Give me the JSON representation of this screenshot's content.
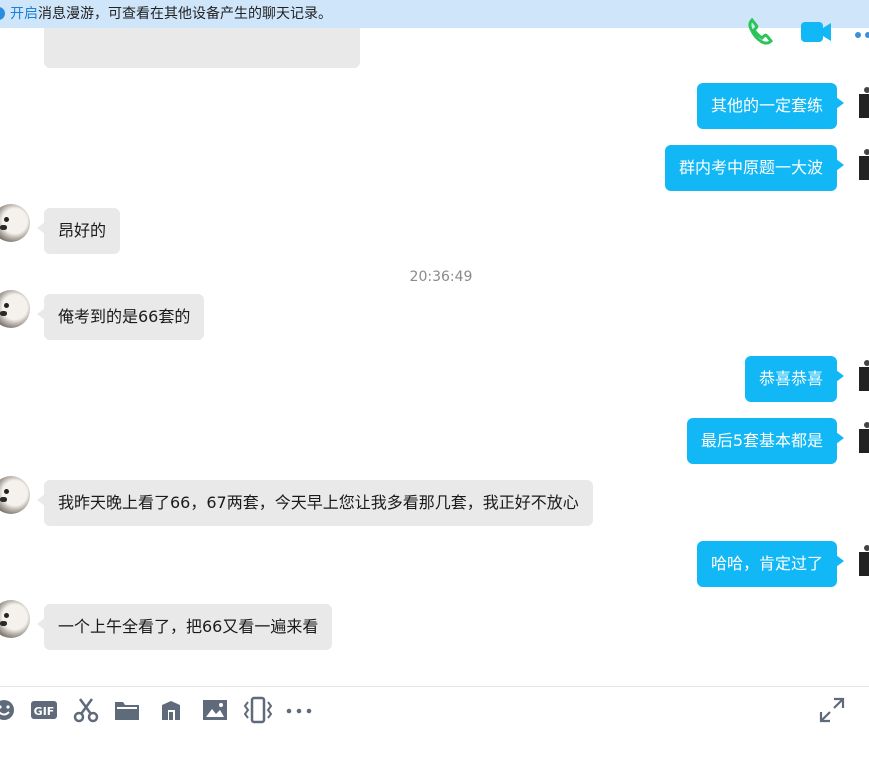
{
  "notice": {
    "link_text": "开启",
    "text": "消息漫游，可查看在其他设备产生的聊天记录。"
  },
  "header_icons": [
    "phone-icon",
    "video-call-icon",
    "more-icon"
  ],
  "messages": [
    {
      "side": "out",
      "text": "其他的一定套练"
    },
    {
      "side": "out",
      "text": "群内考中原题一大波"
    },
    {
      "side": "in",
      "text": "昂好的"
    },
    {
      "side": "time",
      "text": "20:36:49"
    },
    {
      "side": "in",
      "text": "俺考到的是66套的"
    },
    {
      "side": "out",
      "text": "恭喜恭喜"
    },
    {
      "side": "out",
      "text": "最后5套基本都是"
    },
    {
      "side": "in",
      "text": "我昨天晚上看了66，67两套，今天早上您让我多看那几套，我正好不放心"
    },
    {
      "side": "out",
      "text": "哈哈，肯定过了"
    },
    {
      "side": "in",
      "text": "一个上午全看了，把66又看一遍来看"
    }
  ],
  "toolbar": {
    "items": [
      "emoji-icon",
      "gif-icon",
      "scissors-icon",
      "folder-icon",
      "gift-icon",
      "image-icon",
      "shake-icon",
      "more-icon"
    ],
    "gif_label": "GIF",
    "expand": "expand-icon"
  },
  "colors": {
    "notice_bg": "#cfe6fa",
    "link": "#1e7fd6",
    "bubble_out": "#12b7f5",
    "bubble_in": "#e9e9e9",
    "icon": "#5f6b7a"
  }
}
